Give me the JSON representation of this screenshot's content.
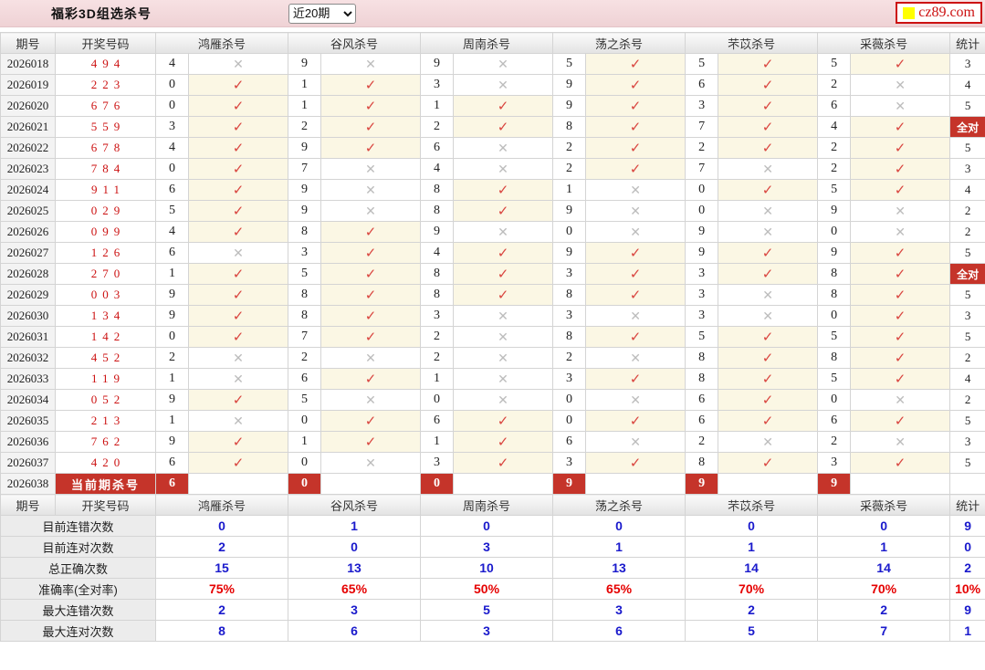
{
  "header": {
    "title": "福彩3D组选杀号",
    "range_select": "近20期",
    "logo_text": "cz89.com"
  },
  "table": {
    "col_period": "期号",
    "col_numbers": "开奖号码",
    "experts": [
      "鸿雁杀号",
      "谷风杀号",
      "周南杀号",
      "荡之杀号",
      "芣苡杀号",
      "采薇杀号"
    ],
    "col_stat": "统计",
    "all_correct_label": "全对",
    "current_label": "当前期杀号",
    "rows": [
      {
        "period": "2026018",
        "numbers": "494",
        "kills": [
          "4",
          "9",
          "9",
          "5",
          "5",
          "5"
        ],
        "hits": [
          0,
          0,
          0,
          1,
          1,
          1
        ],
        "stat": "3"
      },
      {
        "period": "2026019",
        "numbers": "223",
        "kills": [
          "0",
          "1",
          "3",
          "9",
          "6",
          "2"
        ],
        "hits": [
          1,
          1,
          0,
          1,
          1,
          0
        ],
        "stat": "4"
      },
      {
        "period": "2026020",
        "numbers": "676",
        "kills": [
          "0",
          "1",
          "1",
          "9",
          "3",
          "6"
        ],
        "hits": [
          1,
          1,
          1,
          1,
          1,
          0
        ],
        "stat": "5"
      },
      {
        "period": "2026021",
        "numbers": "559",
        "kills": [
          "3",
          "2",
          "2",
          "8",
          "7",
          "4"
        ],
        "hits": [
          1,
          1,
          1,
          1,
          1,
          1
        ],
        "stat": "全对"
      },
      {
        "period": "2026022",
        "numbers": "678",
        "kills": [
          "4",
          "9",
          "6",
          "2",
          "2",
          "2"
        ],
        "hits": [
          1,
          1,
          0,
          1,
          1,
          1
        ],
        "stat": "5"
      },
      {
        "period": "2026023",
        "numbers": "784",
        "kills": [
          "0",
          "7",
          "4",
          "2",
          "7",
          "2"
        ],
        "hits": [
          1,
          0,
          0,
          1,
          0,
          1
        ],
        "stat": "3"
      },
      {
        "period": "2026024",
        "numbers": "911",
        "kills": [
          "6",
          "9",
          "8",
          "1",
          "0",
          "5"
        ],
        "hits": [
          1,
          0,
          1,
          0,
          1,
          1
        ],
        "stat": "4"
      },
      {
        "period": "2026025",
        "numbers": "029",
        "kills": [
          "5",
          "9",
          "8",
          "9",
          "0",
          "9"
        ],
        "hits": [
          1,
          0,
          1,
          0,
          0,
          0
        ],
        "stat": "2"
      },
      {
        "period": "2026026",
        "numbers": "099",
        "kills": [
          "4",
          "8",
          "9",
          "0",
          "9",
          "0"
        ],
        "hits": [
          1,
          1,
          0,
          0,
          0,
          0
        ],
        "stat": "2"
      },
      {
        "period": "2026027",
        "numbers": "126",
        "kills": [
          "6",
          "3",
          "4",
          "9",
          "9",
          "9"
        ],
        "hits": [
          0,
          1,
          1,
          1,
          1,
          1
        ],
        "stat": "5"
      },
      {
        "period": "2026028",
        "numbers": "270",
        "kills": [
          "1",
          "5",
          "8",
          "3",
          "3",
          "8"
        ],
        "hits": [
          1,
          1,
          1,
          1,
          1,
          1
        ],
        "stat": "全对"
      },
      {
        "period": "2026029",
        "numbers": "003",
        "kills": [
          "9",
          "8",
          "8",
          "8",
          "3",
          "8"
        ],
        "hits": [
          1,
          1,
          1,
          1,
          0,
          1
        ],
        "stat": "5"
      },
      {
        "period": "2026030",
        "numbers": "134",
        "kills": [
          "9",
          "8",
          "3",
          "3",
          "3",
          "0"
        ],
        "hits": [
          1,
          1,
          0,
          0,
          0,
          1
        ],
        "stat": "3"
      },
      {
        "period": "2026031",
        "numbers": "142",
        "kills": [
          "0",
          "7",
          "2",
          "8",
          "5",
          "5"
        ],
        "hits": [
          1,
          1,
          0,
          1,
          1,
          1
        ],
        "stat": "5"
      },
      {
        "period": "2026032",
        "numbers": "452",
        "kills": [
          "2",
          "2",
          "2",
          "2",
          "8",
          "8"
        ],
        "hits": [
          0,
          0,
          0,
          0,
          1,
          1
        ],
        "stat": "2"
      },
      {
        "period": "2026033",
        "numbers": "119",
        "kills": [
          "1",
          "6",
          "1",
          "3",
          "8",
          "5"
        ],
        "hits": [
          0,
          1,
          0,
          1,
          1,
          1
        ],
        "stat": "4"
      },
      {
        "period": "2026034",
        "numbers": "052",
        "kills": [
          "9",
          "5",
          "0",
          "0",
          "6",
          "0"
        ],
        "hits": [
          1,
          0,
          0,
          0,
          1,
          0
        ],
        "stat": "2"
      },
      {
        "period": "2026035",
        "numbers": "213",
        "kills": [
          "1",
          "0",
          "6",
          "0",
          "6",
          "6"
        ],
        "hits": [
          0,
          1,
          1,
          1,
          1,
          1
        ],
        "stat": "5"
      },
      {
        "period": "2026036",
        "numbers": "762",
        "kills": [
          "9",
          "1",
          "1",
          "6",
          "2",
          "2"
        ],
        "hits": [
          1,
          1,
          1,
          0,
          0,
          0
        ],
        "stat": "3"
      },
      {
        "period": "2026037",
        "numbers": "420",
        "kills": [
          "6",
          "0",
          "3",
          "3",
          "8",
          "3"
        ],
        "hits": [
          1,
          0,
          1,
          1,
          1,
          1
        ],
        "stat": "5"
      }
    ],
    "current_row": {
      "period": "2026038",
      "label": "当前期杀号",
      "kills": [
        "6",
        "0",
        "0",
        "9",
        "9",
        "9"
      ]
    }
  },
  "summary": {
    "rows": [
      {
        "label": "目前连错次数",
        "values": [
          "0",
          "1",
          "0",
          "0",
          "0",
          "0"
        ],
        "stat": "9",
        "style": "blue"
      },
      {
        "label": "目前连对次数",
        "values": [
          "2",
          "0",
          "3",
          "1",
          "1",
          "1"
        ],
        "stat": "0",
        "style": "blue"
      },
      {
        "label": "总正确次数",
        "values": [
          "15",
          "13",
          "10",
          "13",
          "14",
          "14"
        ],
        "stat": "2",
        "style": "blue"
      },
      {
        "label": "准确率(全对率)",
        "values": [
          "75%",
          "65%",
          "50%",
          "65%",
          "70%",
          "70%"
        ],
        "stat": "10%",
        "style": "red"
      },
      {
        "label": "最大连错次数",
        "values": [
          "2",
          "3",
          "5",
          "3",
          "2",
          "2"
        ],
        "stat": "9",
        "style": "blue"
      },
      {
        "label": "最大连对次数",
        "values": [
          "8",
          "6",
          "3",
          "6",
          "5",
          "7"
        ],
        "stat": "1",
        "style": "blue"
      }
    ]
  },
  "icons": {
    "check": "✓",
    "cross": "✕",
    "logo_square": "yellow-square"
  },
  "colors": {
    "accent_red": "#c5342a",
    "draw_red": "#cc1111",
    "check_red": "#d9453f",
    "cross_gray": "#bcbcbc",
    "hit_bg": "#fbf7e4",
    "value_blue": "#1a1acc",
    "value_red": "#e50000",
    "bar_pink": "#efd2d5",
    "bar_pink_light": "#f7e1e3"
  }
}
